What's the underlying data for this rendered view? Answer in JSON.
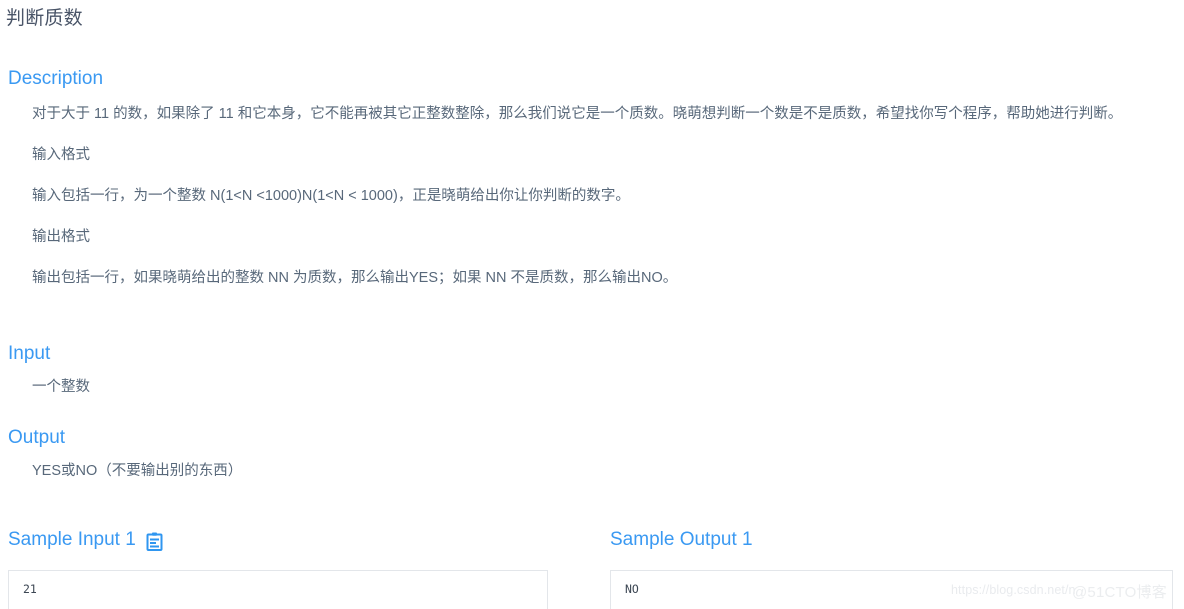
{
  "page": {
    "title": "判断质数"
  },
  "description": {
    "heading": "Description",
    "paragraphs": [
      "对于大于 11 的数，如果除了 11 和它本身，它不能再被其它正整数整除，那么我们说它是一个质数。晓萌想判断一个数是不是质数，希望找你写个程序，帮助她进行判断。",
      "输入格式",
      "输入包括一行，为一个整数 N(1<N <1000)N(1<N < 1000)，正是晓萌给出你让你判断的数字。",
      "输出格式",
      "输出包括一行，如果晓萌给出的整数 NN 为质数，那么输出YES；如果 NN 不是质数，那么输出NO。"
    ]
  },
  "input": {
    "heading": "Input",
    "text": "一个整数"
  },
  "output": {
    "heading": "Output",
    "text": "YES或NO（不要输出别的东西）"
  },
  "samples": {
    "input": {
      "title": "Sample Input 1",
      "copy_icon": "clipboard-copy-icon",
      "value": "21"
    },
    "output": {
      "title": "Sample Output 1",
      "value": "NO"
    }
  },
  "watermarks": {
    "url": "https://blog.csdn.net/n",
    "brand": "@51CTO博客"
  },
  "colors": {
    "heading_blue": "#3a99f2",
    "body_text": "#58687a",
    "title_text": "#4a5568",
    "box_border": "#e3e6ea"
  }
}
